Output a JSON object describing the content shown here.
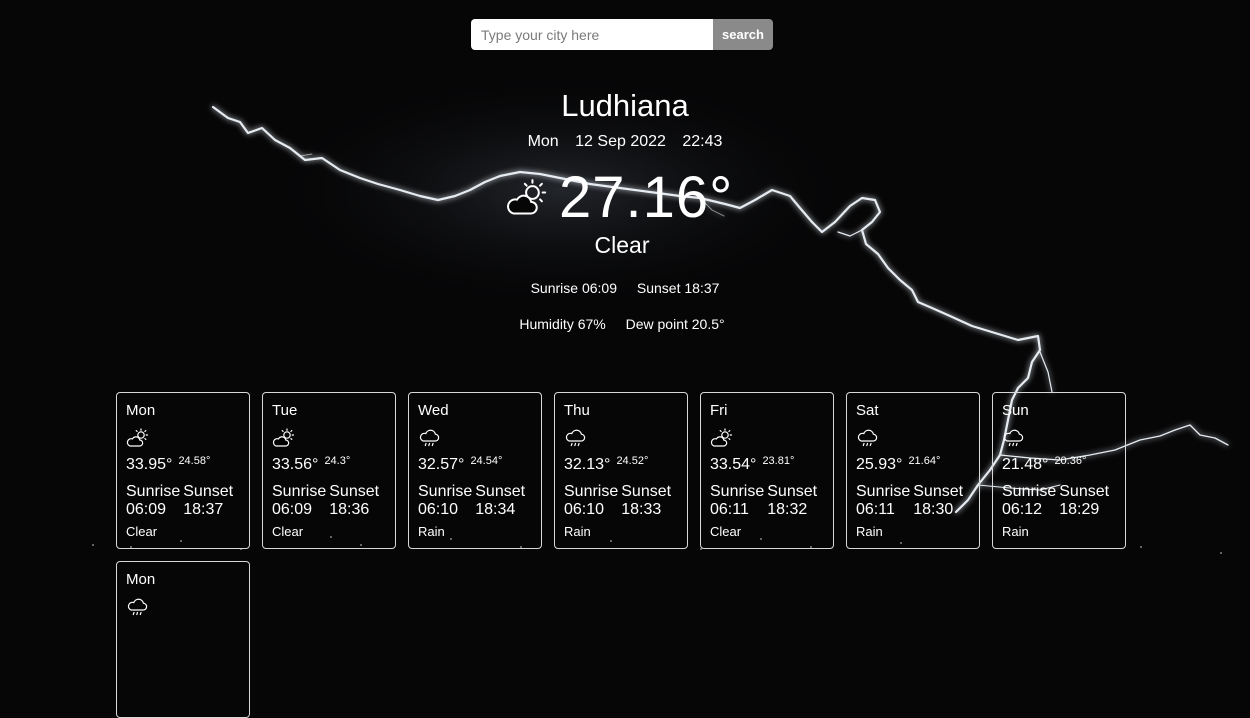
{
  "search": {
    "placeholder": "Type your city here",
    "button_label": "search"
  },
  "current": {
    "city": "Ludhiana",
    "day": "Mon",
    "date": "12 Sep 2022",
    "time": "22:43",
    "icon": "partly-cloudy-icon",
    "temperature": "27.16°",
    "condition": "Clear",
    "sunrise": "Sunrise 06:09",
    "sunset": "Sunset 18:37",
    "humidity": "Humidity 67%",
    "dew_point": "Dew point 20.5°"
  },
  "forecast": [
    {
      "day": "Mon",
      "icon": "partly-cloudy-icon",
      "high": "33.95°",
      "low": "24.58°",
      "sunrise_label": "Sunrise",
      "sunrise": "06:09",
      "sunset_label": "Sunset",
      "sunset": "18:37",
      "condition": "Clear"
    },
    {
      "day": "Tue",
      "icon": "partly-cloudy-icon",
      "high": "33.56°",
      "low": "24.3°",
      "sunrise_label": "Sunrise",
      "sunrise": "06:09",
      "sunset_label": "Sunset",
      "sunset": "18:36",
      "condition": "Clear"
    },
    {
      "day": "Wed",
      "icon": "rain-cloud-icon",
      "high": "32.57°",
      "low": "24.54°",
      "sunrise_label": "Sunrise",
      "sunrise": "06:10",
      "sunset_label": "Sunset",
      "sunset": "18:34",
      "condition": "Rain"
    },
    {
      "day": "Thu",
      "icon": "rain-cloud-icon",
      "high": "32.13°",
      "low": "24.52°",
      "sunrise_label": "Sunrise",
      "sunrise": "06:10",
      "sunset_label": "Sunset",
      "sunset": "18:33",
      "condition": "Rain"
    },
    {
      "day": "Fri",
      "icon": "partly-cloudy-icon",
      "high": "33.54°",
      "low": "23.81°",
      "sunrise_label": "Sunrise",
      "sunrise": "06:11",
      "sunset_label": "Sunset",
      "sunset": "18:32",
      "condition": "Clear"
    },
    {
      "day": "Sat",
      "icon": "rain-cloud-icon",
      "high": "25.93°",
      "low": "21.64°",
      "sunrise_label": "Sunrise",
      "sunrise": "06:11",
      "sunset_label": "Sunset",
      "sunset": "18:30",
      "condition": "Rain"
    },
    {
      "day": "Sun",
      "icon": "rain-cloud-icon",
      "high": "21.48°",
      "low": "20.36°",
      "sunrise_label": "Sunrise",
      "sunrise": "06:12",
      "sunset_label": "Sunset",
      "sunset": "18:29",
      "condition": "Rain"
    },
    {
      "day": "Mon",
      "icon": "rain-cloud-icon",
      "high": "",
      "low": "",
      "sunrise_label": "",
      "sunrise": "",
      "sunset_label": "",
      "sunset": "",
      "condition": ""
    }
  ]
}
